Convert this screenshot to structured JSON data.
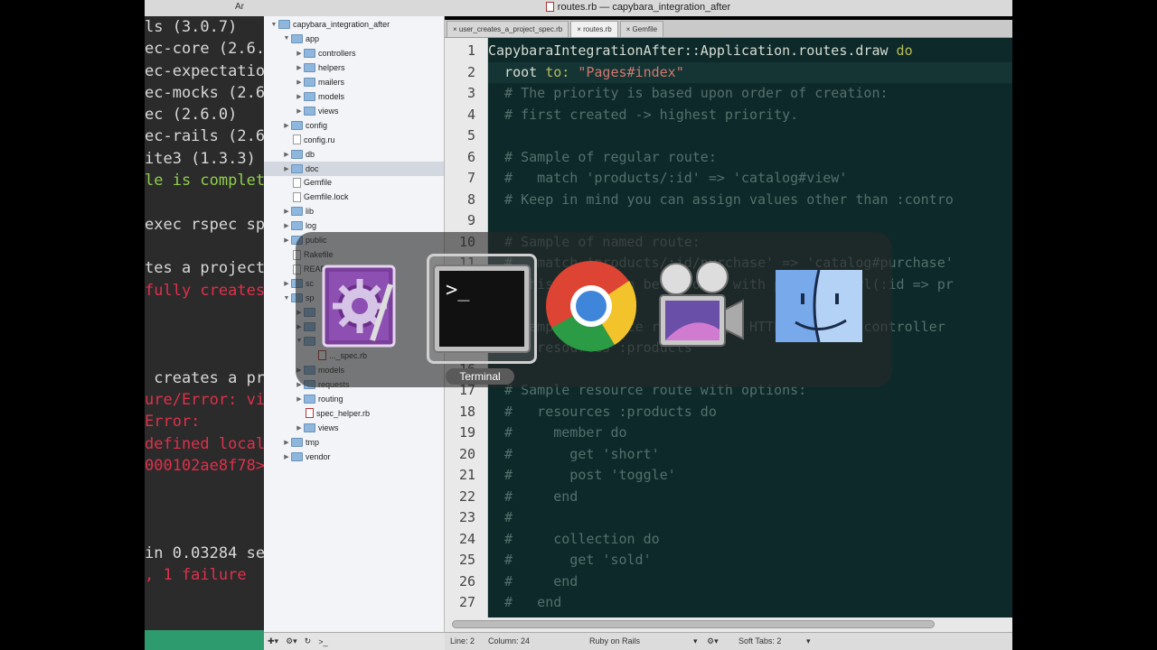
{
  "window": {
    "title": "routes.rb — capybara_integration_after",
    "back_tab_fragment": "Ar"
  },
  "terminal": {
    "lines": [
      {
        "text": "ls (3.0.7)",
        "color": "w"
      },
      {
        "text": "ec-core (2.6.",
        "color": "w"
      },
      {
        "text": "ec-expectatio",
        "color": "w"
      },
      {
        "text": "ec-mocks (2.6",
        "color": "w"
      },
      {
        "text": "ec (2.6.0)",
        "color": "w"
      },
      {
        "text": "ec-rails (2.6",
        "color": "w"
      },
      {
        "text": "ite3 (1.3.3)",
        "color": "w"
      },
      {
        "text": "le is complet",
        "color": "g"
      },
      {
        "text": "",
        "color": "w"
      },
      {
        "text": "exec rspec spe",
        "color": "w"
      },
      {
        "text": "",
        "color": "w"
      },
      {
        "text": "tes a project",
        "color": "w"
      },
      {
        "text": "fully creates",
        "color": "r"
      },
      {
        "text": "",
        "color": "w"
      },
      {
        "text": "",
        "color": "w"
      },
      {
        "text": "",
        "color": "w"
      },
      {
        "text": " creates a pr",
        "color": "w"
      },
      {
        "text": "ure/Error: vi",
        "color": "r"
      },
      {
        "text": "Error:",
        "color": "r"
      },
      {
        "text": "defined local",
        "color": "r"
      },
      {
        "text": "000102ae8f78>",
        "color": "r"
      },
      {
        "text": "",
        "color": "w"
      },
      {
        "text": "",
        "color": "w"
      },
      {
        "text": "",
        "color": "w"
      },
      {
        "text": "in 0.03284 se",
        "color": "w"
      },
      {
        "text": ", 1 failure",
        "color": "r"
      }
    ]
  },
  "tree": [
    {
      "label": "capybara_integration_after",
      "kind": "folder",
      "indent": 0,
      "tri": "▼"
    },
    {
      "label": "app",
      "kind": "folder",
      "indent": 1,
      "tri": "▼"
    },
    {
      "label": "controllers",
      "kind": "folder",
      "indent": 2,
      "tri": "▶"
    },
    {
      "label": "helpers",
      "kind": "folder",
      "indent": 2,
      "tri": "▶"
    },
    {
      "label": "mailers",
      "kind": "folder",
      "indent": 2,
      "tri": "▶"
    },
    {
      "label": "models",
      "kind": "folder",
      "indent": 2,
      "tri": "▶"
    },
    {
      "label": "views",
      "kind": "folder",
      "indent": 2,
      "tri": "▶"
    },
    {
      "label": "config",
      "kind": "folder",
      "indent": 1,
      "tri": "▶"
    },
    {
      "label": "config.ru",
      "kind": "file",
      "indent": 1,
      "tri": ""
    },
    {
      "label": "db",
      "kind": "folder",
      "indent": 1,
      "tri": "▶"
    },
    {
      "label": "doc",
      "kind": "folder",
      "indent": 1,
      "tri": "▶",
      "selected": true
    },
    {
      "label": "Gemfile",
      "kind": "file",
      "indent": 1,
      "tri": ""
    },
    {
      "label": "Gemfile.lock",
      "kind": "file",
      "indent": 1,
      "tri": ""
    },
    {
      "label": "lib",
      "kind": "folder",
      "indent": 1,
      "tri": "▶"
    },
    {
      "label": "log",
      "kind": "folder",
      "indent": 1,
      "tri": "▶"
    },
    {
      "label": "public",
      "kind": "folder",
      "indent": 1,
      "tri": "▶"
    },
    {
      "label": "Rakefile",
      "kind": "file",
      "indent": 1,
      "tri": ""
    },
    {
      "label": "READ",
      "kind": "file",
      "indent": 1,
      "tri": ""
    },
    {
      "label": "sc",
      "kind": "folder",
      "indent": 1,
      "tri": "▶"
    },
    {
      "label": "sp",
      "kind": "folder",
      "indent": 1,
      "tri": "▼"
    },
    {
      "label": "",
      "kind": "folder",
      "indent": 2,
      "tri": "▶"
    },
    {
      "label": "",
      "kind": "folder",
      "indent": 2,
      "tri": "▶"
    },
    {
      "label": "",
      "kind": "folder",
      "indent": 2,
      "tri": "▼"
    },
    {
      "label": "..._spec.rb",
      "kind": "rb",
      "indent": 3,
      "tri": ""
    },
    {
      "label": "models",
      "kind": "folder",
      "indent": 2,
      "tri": "▶"
    },
    {
      "label": "requests",
      "kind": "folder",
      "indent": 2,
      "tri": "▶"
    },
    {
      "label": "routing",
      "kind": "folder",
      "indent": 2,
      "tri": "▶"
    },
    {
      "label": "spec_helper.rb",
      "kind": "rb",
      "indent": 2,
      "tri": ""
    },
    {
      "label": "views",
      "kind": "folder",
      "indent": 2,
      "tri": "▶"
    },
    {
      "label": "tmp",
      "kind": "folder",
      "indent": 1,
      "tri": "▶"
    },
    {
      "label": "vendor",
      "kind": "folder",
      "indent": 1,
      "tri": "▶"
    }
  ],
  "tabs": [
    {
      "label": "× user_creates_a_project_spec.rb",
      "active": false
    },
    {
      "label": "× routes.rb",
      "active": true
    },
    {
      "label": "× Gemfile",
      "active": false
    }
  ],
  "editor": {
    "lines": [
      {
        "n": "1",
        "tokens": [
          {
            "t": "CapybaraIntegrationAfter::Application.routes.draw ",
            "c": "cls"
          },
          {
            "t": "do",
            "c": "kw"
          }
        ]
      },
      {
        "n": "2",
        "hl": true,
        "tokens": [
          {
            "t": "  root ",
            "c": "pl"
          },
          {
            "t": "to:",
            "c": "kw"
          },
          {
            "t": " ",
            "c": "pl"
          },
          {
            "t": "\"Pages#index\"",
            "c": "str"
          }
        ]
      },
      {
        "n": "3",
        "tokens": [
          {
            "t": "  # The priority is based upon order of creation:",
            "c": "cm"
          }
        ]
      },
      {
        "n": "4",
        "tokens": [
          {
            "t": "  # first created -> highest priority.",
            "c": "cm"
          }
        ]
      },
      {
        "n": "5",
        "tokens": []
      },
      {
        "n": "6",
        "tokens": [
          {
            "t": "  # Sample of regular route:",
            "c": "cm"
          }
        ]
      },
      {
        "n": "7",
        "tokens": [
          {
            "t": "  #   match 'products/:id' => 'catalog#view'",
            "c": "cm"
          }
        ]
      },
      {
        "n": "8",
        "tokens": [
          {
            "t": "  # Keep in mind you can assign values other than :contro",
            "c": "cm"
          }
        ]
      },
      {
        "n": "9",
        "tokens": []
      },
      {
        "n": "10",
        "tokens": [
          {
            "t": "  # Sample of named route:",
            "c": "cm"
          }
        ]
      },
      {
        "n": "11",
        "tokens": [
          {
            "t": "  #   match 'products/:id/purchase' => 'catalog#purchase'",
            "c": "cm"
          }
        ]
      },
      {
        "n": "12",
        "tokens": [
          {
            "t": "  # This route can be invoked with purchase_url(:id => pr",
            "c": "cm"
          }
        ]
      },
      {
        "n": "13",
        "tokens": []
      },
      {
        "n": "14",
        "tokens": [
          {
            "t": "  # Sample resource route (maps HTTP verbs to controller",
            "c": "cm"
          }
        ]
      },
      {
        "n": "15",
        "tokens": [
          {
            "t": "  #   resources :products",
            "c": "cm"
          }
        ]
      },
      {
        "n": "16",
        "tokens": []
      },
      {
        "n": "17",
        "tokens": [
          {
            "t": "  # Sample resource route with options:",
            "c": "cm"
          }
        ]
      },
      {
        "n": "18",
        "tokens": [
          {
            "t": "  #   resources :products do",
            "c": "cm"
          }
        ]
      },
      {
        "n": "19",
        "tokens": [
          {
            "t": "  #     member do",
            "c": "cm"
          }
        ]
      },
      {
        "n": "20",
        "tokens": [
          {
            "t": "  #       get 'short'",
            "c": "cm"
          }
        ]
      },
      {
        "n": "21",
        "tokens": [
          {
            "t": "  #       post 'toggle'",
            "c": "cm"
          }
        ]
      },
      {
        "n": "22",
        "tokens": [
          {
            "t": "  #     end",
            "c": "cm"
          }
        ]
      },
      {
        "n": "23",
        "tokens": [
          {
            "t": "  #",
            "c": "cm"
          }
        ]
      },
      {
        "n": "24",
        "tokens": [
          {
            "t": "  #     collection do",
            "c": "cm"
          }
        ]
      },
      {
        "n": "25",
        "tokens": [
          {
            "t": "  #       get 'sold'",
            "c": "cm"
          }
        ]
      },
      {
        "n": "26",
        "tokens": [
          {
            "t": "  #     end",
            "c": "cm"
          }
        ]
      },
      {
        "n": "27",
        "tokens": [
          {
            "t": "  #   end",
            "c": "cm"
          }
        ]
      }
    ]
  },
  "statusbar": {
    "line": "Line: 2",
    "column": "Column: 24",
    "language": "Ruby on Rails",
    "tabs": "Soft Tabs:  2"
  },
  "switcher": {
    "apps": [
      {
        "name": "xcode-instruments-icon"
      },
      {
        "name": "terminal-icon",
        "selected": true
      },
      {
        "name": "chrome-icon"
      },
      {
        "name": "screenflow-icon"
      },
      {
        "name": "finder-icon"
      }
    ],
    "selected_label": "Terminal"
  }
}
